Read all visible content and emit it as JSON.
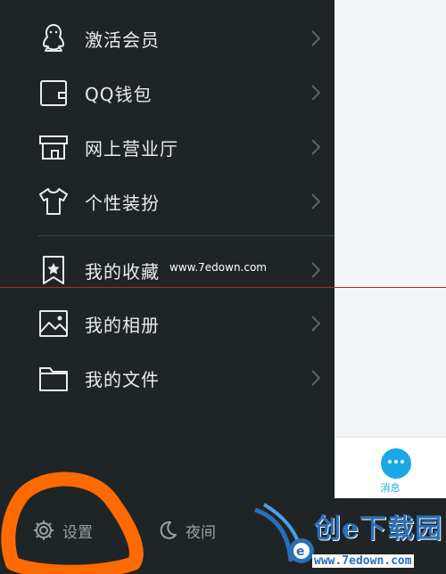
{
  "menu": {
    "items": [
      {
        "label": "激活会员",
        "icon": "penguin-icon"
      },
      {
        "label": "QQ钱包",
        "icon": "wallet-icon"
      },
      {
        "label": "网上营业厅",
        "icon": "store-icon"
      },
      {
        "label": "个性装扮",
        "icon": "tshirt-icon"
      },
      {
        "label": "我的收藏",
        "icon": "bookmark-star-icon"
      },
      {
        "label": "我的相册",
        "icon": "photo-icon"
      },
      {
        "label": "我的文件",
        "icon": "folder-icon"
      }
    ]
  },
  "bottom_bar": {
    "settings_label": "设置",
    "night_label": "夜间"
  },
  "right_pane": {
    "messages_label": "消息"
  },
  "watermarks": {
    "overlay_text": "www.7edown.com",
    "brand_name": "创e下载园",
    "brand_url": "www.7edown.com"
  },
  "colors": {
    "drawer_background": "#1f2526",
    "accent_blue": "#1aa7e8",
    "annotation_orange": "#ff6a00",
    "guide_line_red": "#c3201f"
  }
}
